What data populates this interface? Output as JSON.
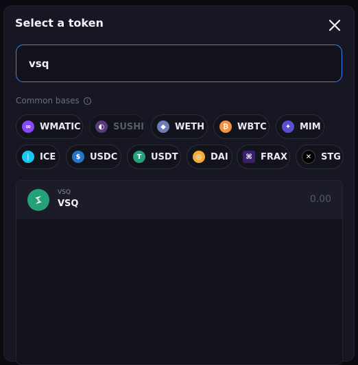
{
  "modal": {
    "title": "Select a token"
  },
  "search": {
    "value": "vsq",
    "placeholder": ""
  },
  "common_bases": {
    "label": "Common bases",
    "row1": [
      {
        "symbol": "WMATIC",
        "icon": "wmatic-icon",
        "color": "#8a46ff"
      },
      {
        "symbol": "SUSHI",
        "icon": "sushi-icon",
        "color": "#5a3b7a"
      },
      {
        "symbol": "WETH",
        "icon": "weth-icon",
        "color": "#6a7bb6"
      },
      {
        "symbol": "WBTC",
        "icon": "wbtc-icon",
        "color": "#f09242"
      },
      {
        "symbol": "MIM",
        "icon": "mim-icon",
        "color": "#5a4fcf"
      }
    ],
    "row2": [
      {
        "symbol": "ICE",
        "icon": "ice-icon",
        "color": "#16c8f2"
      },
      {
        "symbol": "USDC",
        "icon": "usdc-icon",
        "color": "#2775ca"
      },
      {
        "symbol": "USDT",
        "icon": "usdt-icon",
        "color": "#26a17b"
      },
      {
        "symbol": "DAI",
        "icon": "dai-icon",
        "color": "#f5ac37"
      },
      {
        "symbol": "FRAX",
        "icon": "frax-icon",
        "color": "#3a1f6b"
      },
      {
        "symbol": "STG",
        "icon": "stg-icon",
        "color": "#000000"
      }
    ]
  },
  "results": [
    {
      "symbol": "VSQ",
      "name": "VSQ",
      "balance": "0.00",
      "icon": "vsq-icon",
      "color": "#25a078"
    }
  ]
}
